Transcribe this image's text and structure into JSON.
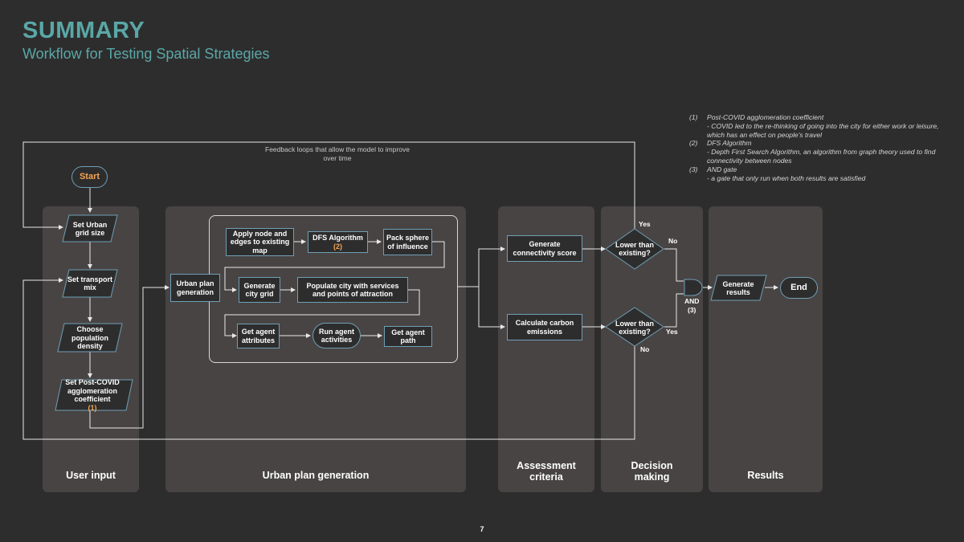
{
  "header": {
    "title": "SUMMARY",
    "subtitle": "Workflow for Testing Spatial Strategies"
  },
  "feedback_note": "Feedback loops that allow the model to improve over time",
  "panels": {
    "user_input": "User input",
    "urban_plan_generation": "Urban plan generation",
    "assessment_criteria": "Assessment criteria",
    "decision_making": "Decision making",
    "results": "Results"
  },
  "nodes": {
    "start": "Start",
    "set_grid": "Set Urban grid size",
    "set_transport": "Set transport mix",
    "choose_density": "Choose population density",
    "set_covid": "Set Post-COVID agglomeration coefficient",
    "set_covid_ref": "(1)",
    "urban_plan_generation": "Urban plan generation",
    "apply_nodes": "Apply node and edges to existing map",
    "dfs": "DFS Algorithm",
    "dfs_ref": "(2)",
    "pack_sphere": "Pack sphere of influence",
    "generate_grid": "Generate city grid",
    "populate_city": "Populate city with services and points of attraction",
    "agent_attributes": "Get agent attributes",
    "run_agent": "Run agent activities",
    "agent_path": "Get agent path",
    "connectivity_score": "Generate connectivity score",
    "carbon": "Calculate carbon emissions",
    "lower_top": "Lower than existing?",
    "lower_bottom": "Lower than existing?",
    "generate_results": "Generate results",
    "end": "End"
  },
  "decision_labels": {
    "top_yes": "Yes",
    "top_no": "No",
    "bottom_yes": "Yes",
    "bottom_no": "No",
    "and_gate": "AND",
    "and_ref": "(3)"
  },
  "notes": [
    {
      "num": "(1)",
      "title": "Post-COVID agglomeration coefficient",
      "desc": "- COVID led to the re-thinking of going into the city for either work or leisure, which has an effect on people's travel"
    },
    {
      "num": "(2)",
      "title": "DFS Algorithm",
      "desc": "- Depth First Search Algorithm, an algorithm from graph theory used to find connectivity between nodes"
    },
    {
      "num": "(3)",
      "title": "AND gate",
      "desc": "- a gate that only run when both results are satisfied"
    }
  ],
  "page_number": "7",
  "colors": {
    "background": "#2e2d2d",
    "panel": "#484444",
    "accent_teal": "#5aa7a7",
    "node_border": "#6f9fb6",
    "reference_orange": "#f4a455"
  }
}
